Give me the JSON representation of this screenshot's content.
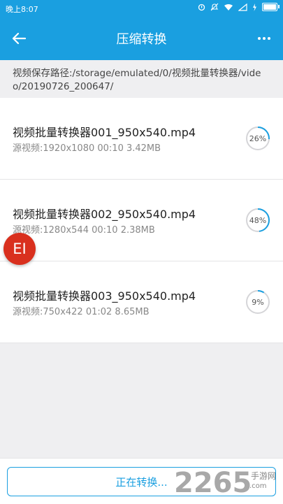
{
  "status_bar": {
    "time": "晚上8:07",
    "icons": [
      "notification-icon",
      "mute-icon",
      "wifi-icon",
      "signal-icon",
      "charging-icon",
      "battery-icon"
    ]
  },
  "header": {
    "title": "压缩转换",
    "back_icon": "arrow-left-icon",
    "more_icon": "more-dots-icon"
  },
  "path_text": "视频保存路径:/storage/emulated/0/视频批量转换器/video/20190726_200647/",
  "items": [
    {
      "name": "视频批量转换器001_950x540.mp4",
      "meta": "源视频:1920x1080 00:10 3.42MB",
      "progress_label": "26%",
      "progress": 0.26
    },
    {
      "name": "视频批量转换器002_950x540.mp4",
      "meta": "源视频:1280x544 00:10 2.38MB",
      "progress_label": "48%",
      "progress": 0.48
    },
    {
      "name": "视频批量转换器003_950x540.mp4",
      "meta": "源视频:750x422 01:02 8.65MB",
      "progress_label": "9%",
      "progress": 0.09
    }
  ],
  "floating_badge": "EI",
  "convert_button_label": "正在转换...",
  "watermark": {
    "number": "2265",
    "cn": "手游网",
    "url": ".com"
  },
  "colors": {
    "accent": "#1a9fe0",
    "badge": "#d9301e"
  }
}
